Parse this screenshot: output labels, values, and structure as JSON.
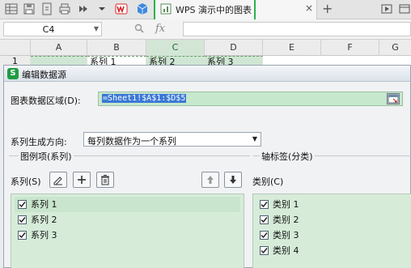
{
  "toolbar": {
    "icons": [
      "grid-icon",
      "save-icon",
      "export-icon",
      "print-icon",
      "more-icon",
      "chevron-down-icon",
      "wps-icon",
      "cube-icon"
    ],
    "wps_label": "W"
  },
  "doc_tab": {
    "label": "WPS 演示中的图表",
    "close": "×",
    "add": "+"
  },
  "formula_bar": {
    "cell_ref": "C4",
    "fx": "fx"
  },
  "columns": [
    "A",
    "B",
    "C",
    "D",
    "E",
    "F",
    "G"
  ],
  "selected_column": "C",
  "sheet_row1": {
    "row_number": "1",
    "cells": [
      "",
      "系列 1",
      "系列 2",
      "系列 3"
    ]
  },
  "dialog": {
    "title": "编辑数据源",
    "icon_letter": "S",
    "range_label": "图表数据区域(D):",
    "range_value": "=Sheet1!$A$1:$D$5",
    "direction_label": "系列生成方向:",
    "direction_value": "每列数据作为一个系列",
    "series_group": {
      "legend": "图例项(系列)",
      "list_label": "系列(S)",
      "items": [
        "系列 1",
        "系列 2",
        "系列 3"
      ]
    },
    "category_group": {
      "legend": "轴标签(分类)",
      "list_label": "类别(C)",
      "items": [
        "类别 1",
        "类别 2",
        "类别 3",
        "类别 4"
      ]
    }
  },
  "colors": {
    "accent_green": "#2db04a",
    "list_bg": "#d6ecd9",
    "selection_blue": "#3a78d6"
  }
}
